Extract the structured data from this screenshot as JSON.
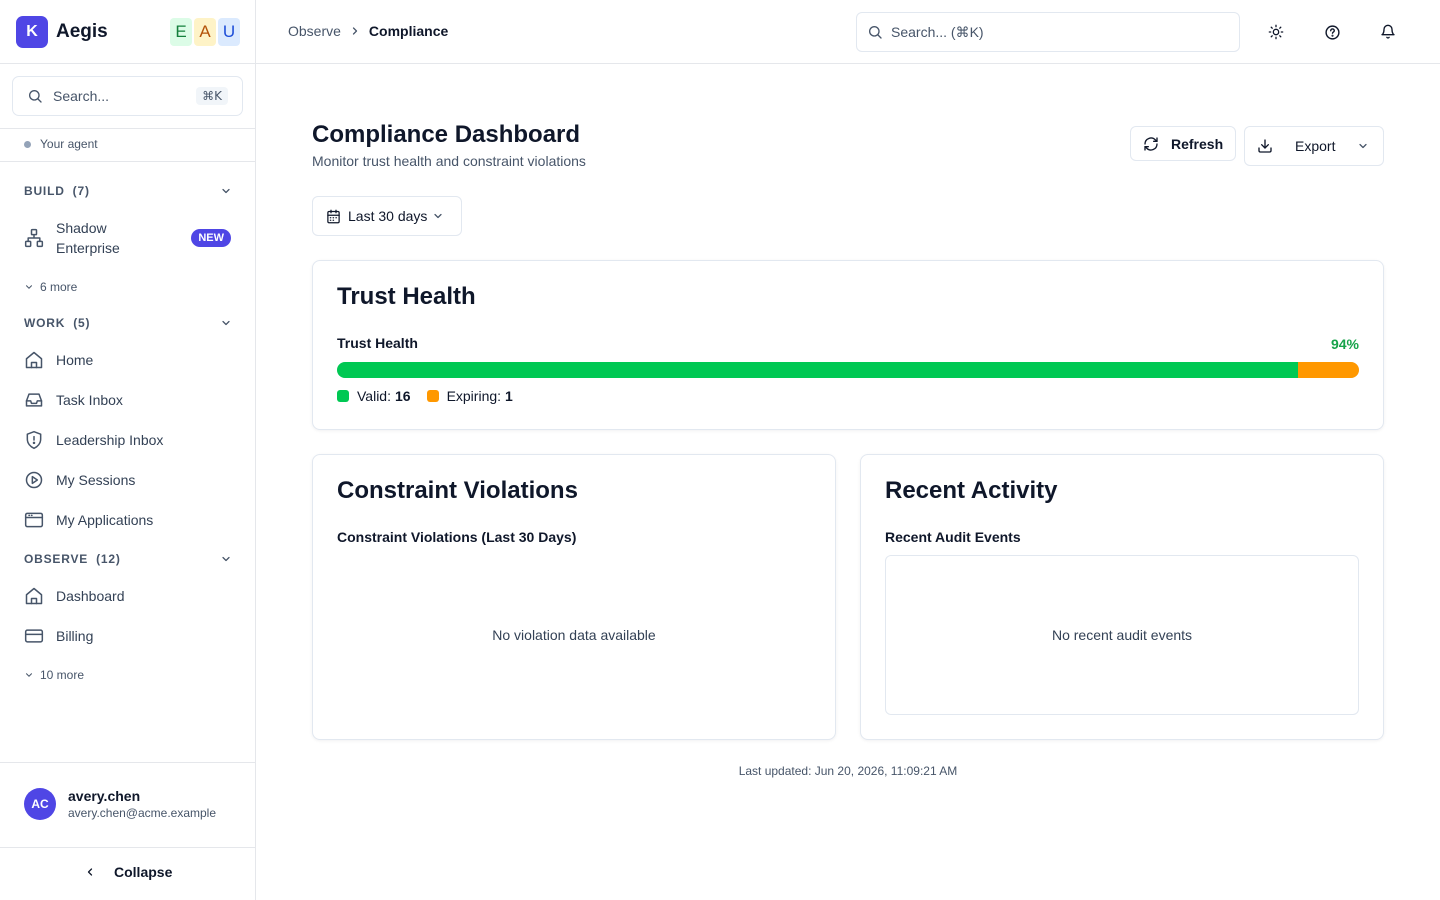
{
  "brand": {
    "logo_letter": "K",
    "name": "Aegis",
    "workspaces": [
      {
        "letter": "E",
        "bg": "#dcfce7",
        "fg": "#15803d"
      },
      {
        "letter": "A",
        "bg": "#fef3c7",
        "fg": "#b45309"
      },
      {
        "letter": "U",
        "bg": "#dbeafe",
        "fg": "#1d4ed8"
      }
    ]
  },
  "sidebar": {
    "search_placeholder": "Search...",
    "search_shortcut": "⌘K",
    "agent_label": "Your agent",
    "sections": {
      "build": {
        "label": "BUILD",
        "count": "(7)",
        "items": [
          {
            "label": "Shadow Enterprise",
            "icon": "hierarchy-icon",
            "badge": "NEW"
          }
        ],
        "more": "6 more"
      },
      "work": {
        "label": "WORK",
        "count": "(5)",
        "items": [
          {
            "label": "Home",
            "icon": "home-icon"
          },
          {
            "label": "Task Inbox",
            "icon": "inbox-icon"
          },
          {
            "label": "Leadership Inbox",
            "icon": "shield-alert-icon"
          },
          {
            "label": "My Sessions",
            "icon": "play-circle-icon"
          },
          {
            "label": "My Applications",
            "icon": "app-window-icon"
          }
        ]
      },
      "observe": {
        "label": "OBSERVE",
        "count": "(12)",
        "items": [
          {
            "label": "Dashboard",
            "icon": "home-icon"
          },
          {
            "label": "Billing",
            "icon": "credit-card-icon"
          }
        ],
        "more": "10 more"
      }
    },
    "user": {
      "initials": "AC",
      "name": "avery.chen",
      "email": "avery.chen@acme.example"
    },
    "collapse_label": "Collapse"
  },
  "topbar": {
    "breadcrumb": {
      "parent": "Observe",
      "current": "Compliance"
    },
    "search_placeholder": "Search... (⌘K)",
    "icons": [
      "sun-icon",
      "help-circle-icon",
      "bell-icon"
    ]
  },
  "page": {
    "title": "Compliance Dashboard",
    "subtitle": "Monitor trust health and constraint violations",
    "refresh_label": "Refresh",
    "export_label": "Export",
    "date_range": "Last 30 days"
  },
  "trust_health": {
    "card_title": "Trust Health",
    "bar_label": "Trust Health",
    "percent_label": "94%",
    "valid_fraction": 0.94,
    "expiring_fraction": 0.06,
    "legend": {
      "valid_label": "Valid:",
      "valid_value": "16",
      "expiring_label": "Expiring:",
      "expiring_value": "1"
    },
    "colors": {
      "valid": "#00c853",
      "expiring": "#ff9800",
      "accent_text": "#16a34a"
    }
  },
  "violations": {
    "card_title": "Constraint Violations",
    "chart_title": "Constraint Violations (Last 30 Days)",
    "empty": "No violation data available"
  },
  "activity": {
    "card_title": "Recent Activity",
    "list_title": "Recent Audit Events",
    "empty": "No recent audit events"
  },
  "footer": {
    "last_updated": "Last updated: Jun 20, 2026, 11:09:21 AM"
  },
  "colors": {
    "brand": "#4f46e5",
    "border": "#e2e8f0",
    "muted_text": "#475569"
  }
}
